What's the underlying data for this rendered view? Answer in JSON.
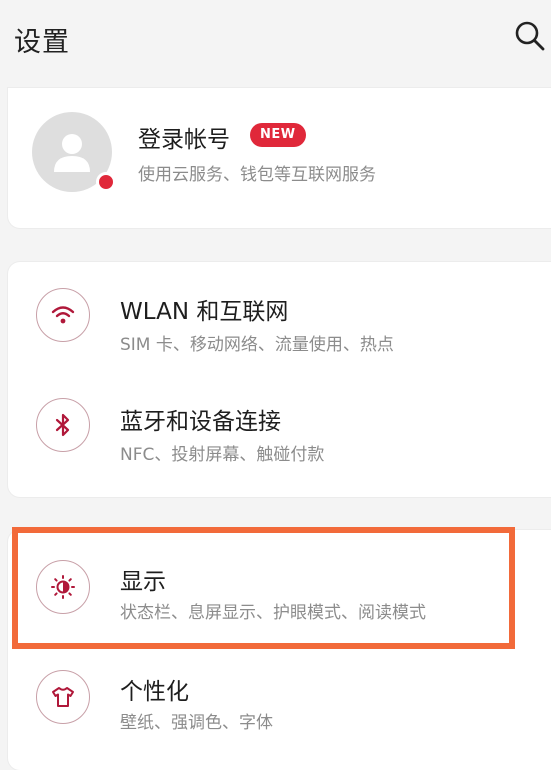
{
  "header": {
    "title": "设置",
    "search_icon": "search-icon"
  },
  "account": {
    "title": "登录帐号",
    "badge": "NEW",
    "subtitle": "使用云服务、钱包等互联网服务",
    "avatar_icon": "user-avatar-icon",
    "dot_color": "#e0283a"
  },
  "settings": [
    {
      "title": "WLAN 和互联网",
      "subtitle": "SIM 卡、移动网络、流量使用、热点",
      "icon": "wifi-icon"
    },
    {
      "title": "蓝牙和设备连接",
      "subtitle": "NFC、投射屏幕、触碰付款",
      "icon": "bluetooth-icon"
    },
    {
      "title": "显示",
      "subtitle": "状态栏、息屏显示、护眼模式、阅读模式",
      "icon": "brightness-icon"
    },
    {
      "title": "个性化",
      "subtitle": "壁纸、强调色、字体",
      "icon": "tshirt-icon"
    }
  ],
  "colors": {
    "accent": "#b0183a",
    "highlight": "#f26a3a",
    "badge": "#e0283a"
  }
}
